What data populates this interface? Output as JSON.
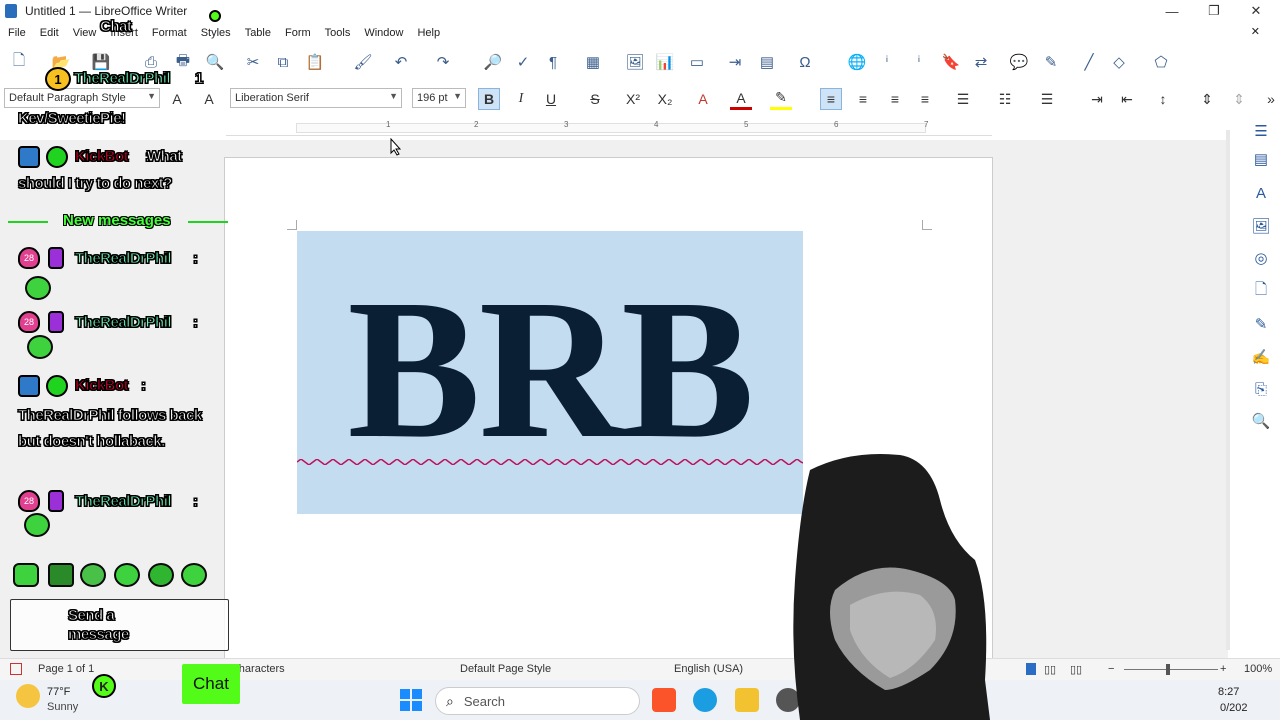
{
  "window": {
    "title": "Untitled 1 — LibreOffice Writer",
    "minimize": "—",
    "maximize": "❐",
    "close": "✕"
  },
  "menu": {
    "items": [
      "File",
      "Edit",
      "View",
      "Insert",
      "Format",
      "Styles",
      "Table",
      "Form",
      "Tools",
      "Window",
      "Help"
    ],
    "close_doc": "✕"
  },
  "formatting": {
    "paragraph_style": "Default Paragraph Style",
    "font_name": "Liberation Serif",
    "font_size": "196 pt"
  },
  "ruler": {
    "numbers": [
      "1",
      "2",
      "3",
      "4",
      "5",
      "6",
      "7"
    ]
  },
  "document": {
    "text": "BRB"
  },
  "status": {
    "page": "Page 1 of 1",
    "words": "1 word, 3 characters",
    "page_style": "Default Page Style",
    "language": "English (USA)",
    "zoom": "100%"
  },
  "taskbar": {
    "weather_temp": "77°F",
    "weather_desc": "Sunny",
    "search_placeholder": "Search",
    "time": "8:27",
    "date": "0/202"
  },
  "chat": {
    "header": "Chat",
    "messages": [
      {
        "user": "TheRealDrPhil",
        "suffix": "1"
      },
      {
        "text": "Kev/SweetiePie!"
      },
      {
        "user": "KickBot",
        "text": "What should I try to do next?"
      },
      {
        "user": "TheRealDrPhil",
        "text": ""
      },
      {
        "user": "TheRealDrPhil",
        "text": ""
      },
      {
        "user": "KickBot",
        "text": "TheRealDrPhil follows back but doesn't hollaback."
      },
      {
        "user": "TheRealDrPhil",
        "text": ""
      }
    ],
    "new_messages": "New messages",
    "badge_number": "1",
    "sub_months": "28",
    "send_placeholder": "Send a message",
    "chat_button": "Chat"
  },
  "colors": {
    "selection": "#c4dcf0",
    "text": "#0a1f33",
    "chat_name": "#6ef5b8",
    "bot_name": "#d0002a",
    "kick_green": "#53fc18"
  }
}
